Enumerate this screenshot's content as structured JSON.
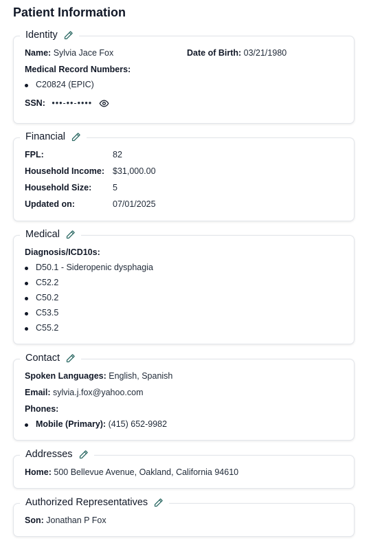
{
  "page_title": "Patient Information",
  "colors": {
    "edit_icon": "#2f6b66",
    "border": "#e2e5ea"
  },
  "identity": {
    "title": "Identity",
    "name_label": "Name:",
    "name_value": "Sylvia Jace Fox",
    "dob_label": "Date of Birth:",
    "dob_value": "03/21/1980",
    "mrn_label": "Medical Record Numbers:",
    "mrns": [
      "C20824 (EPIC)"
    ],
    "ssn_label": "SSN:",
    "ssn_value": "•••-••-••••"
  },
  "financial": {
    "title": "Financial",
    "fpl_label": "FPL:",
    "fpl_value": "82",
    "income_label": "Household Income:",
    "income_value": "$31,000.00",
    "size_label": "Household Size:",
    "size_value": "5",
    "updated_label": "Updated on:",
    "updated_value": "07/01/2025"
  },
  "medical": {
    "title": "Medical",
    "dx_label": "Diagnosis/ICD10s:",
    "diagnoses": [
      "D50.1 - Sideropenic dysphagia",
      "C52.2",
      "C50.2",
      "C53.5",
      "C55.2"
    ]
  },
  "contact": {
    "title": "Contact",
    "languages_label": "Spoken Languages:",
    "languages_value": "English, Spanish",
    "email_label": "Email:",
    "email_value": "sylvia.j.fox@yahoo.com",
    "phones_label": "Phones:",
    "phones": [
      {
        "type": "Mobile (Primary):",
        "number": "(415) 652-9982"
      }
    ]
  },
  "addresses": {
    "title": "Addresses",
    "home_label": "Home:",
    "home_value": "500 Bellevue Avenue, Oakland, California 94610"
  },
  "representatives": {
    "title": "Authorized Representatives",
    "rep_label": "Son:",
    "rep_value": "Jonathan P Fox"
  }
}
